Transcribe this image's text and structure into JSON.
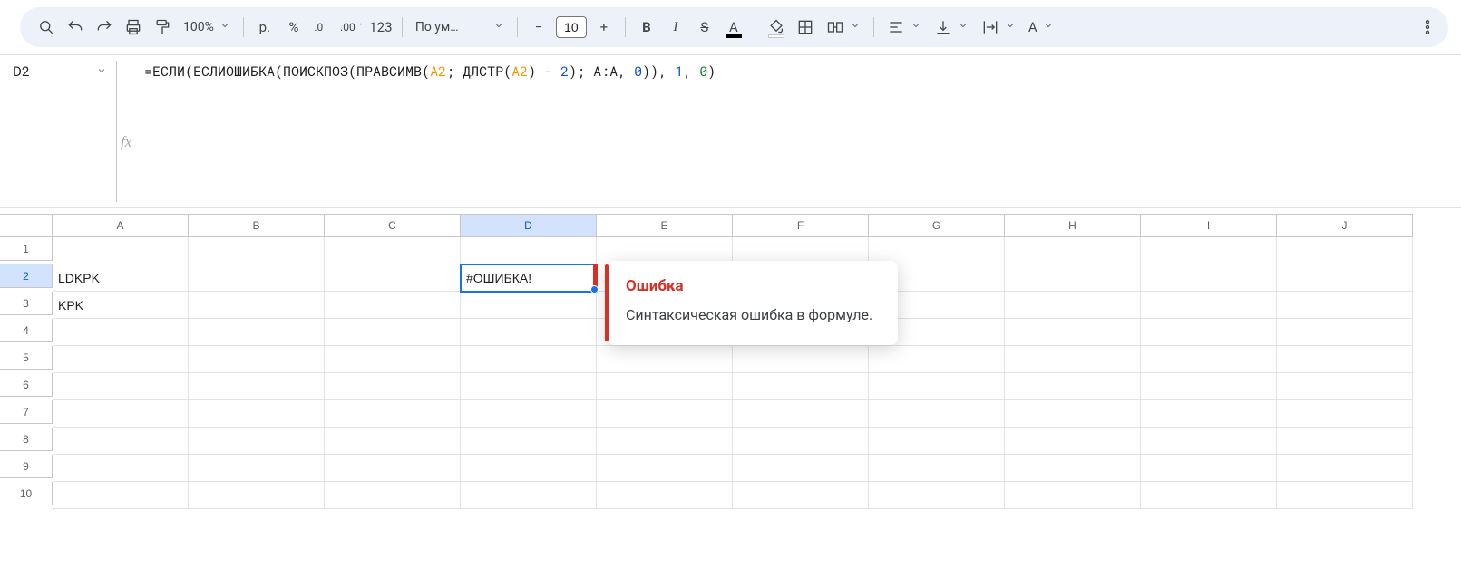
{
  "toolbar": {
    "zoom": "100%",
    "currency_symbol": "р.",
    "percent_symbol": "%",
    "dec_less": ".0",
    "dec_more": ".00",
    "number_format": "123",
    "font_name": "По ум…",
    "font_size": "10"
  },
  "name_box": "D2",
  "formula": {
    "p1": "=ЕСЛИ(ЕСЛИОШИБКА(ПОИСКПОЗ(ПРАВСИМВ(",
    "ref1": "A2",
    "p2": "; ДЛСТР(",
    "ref2": "A2",
    "p3": ") - ",
    "n1": "2",
    "p4": "); A:A, ",
    "n2": "0",
    "p5": ")), ",
    "n3": "1",
    "p6": ", ",
    "n4": "0",
    "p7": ")"
  },
  "fx_label": "fx",
  "columns": [
    "A",
    "B",
    "C",
    "D",
    "E",
    "F",
    "G",
    "H",
    "I",
    "J"
  ],
  "rows": [
    "1",
    "2",
    "3",
    "4",
    "5",
    "6",
    "7",
    "8",
    "9",
    "10"
  ],
  "selected_col_index": 3,
  "selected_row_index": 1,
  "cells": {
    "A2": "LDKPK",
    "A3": "KPK",
    "D2": "#ОШИБКА!"
  },
  "tooltip": {
    "title": "Ошибка",
    "body": "Синтаксическая ошибка в формуле."
  }
}
